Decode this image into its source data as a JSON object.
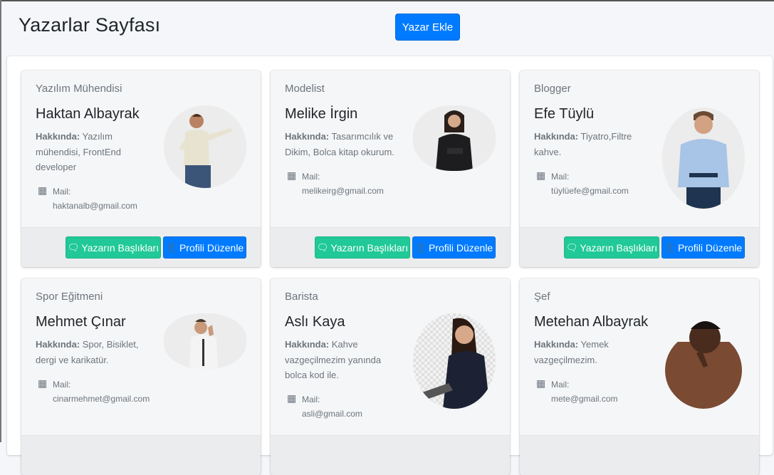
{
  "page": {
    "title": "Yazarlar Sayfası",
    "add_button": "Yazar Ekle"
  },
  "labels": {
    "about": "Hakkında:",
    "mail": "Mail:",
    "topics_button": "Yazarın Başlıkları",
    "edit_button": "Profili Düzenle"
  },
  "colors": {
    "primary": "#007bff",
    "success": "#20c997"
  },
  "icons": {
    "topics": "comments-icon",
    "edit": "user-icon",
    "mail": "building-icon"
  },
  "authors": [
    {
      "title": "Yazılım Mühendisi",
      "name": "Haktan Albayrak",
      "about": "Yazılım mühendisi, FrontEnd developer",
      "mail": "haktanalb@gmail.com"
    },
    {
      "title": "Modelist",
      "name": "Melike İrgin",
      "about": "Tasarımcılık ve Dikim, Bolca kitap okurum.",
      "mail": "melikeirg@gmail.com"
    },
    {
      "title": "Blogger",
      "name": "Efe Tüylü",
      "about": "Tiyatro,Filtre kahve.",
      "mail": "tüylüefe@gmail.com"
    },
    {
      "title": "Spor Eğitmeni",
      "name": "Mehmet Çınar",
      "about": "Spor, Bisiklet, dergi ve karikatür.",
      "mail": "cinarmehmet@gmail.com"
    },
    {
      "title": "Barista",
      "name": "Aslı Kaya",
      "about": "Kahve vazgeçilmezim yanında bolca kod ile.",
      "mail": "asli@gmail.com"
    },
    {
      "title": "Şef",
      "name": "Metehan Albayrak",
      "about": "Yemek vazgeçilmezim.",
      "mail": "mete@gmail.com"
    }
  ]
}
